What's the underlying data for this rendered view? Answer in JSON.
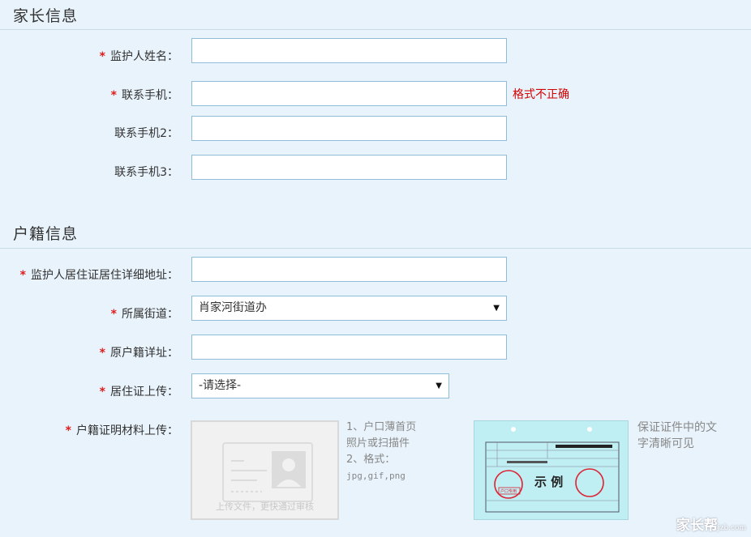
{
  "parent_section": {
    "title": "家长信息",
    "guardian_name_label": "监护人姓名：",
    "phone_label": "联系手机：",
    "phone_error": "格式不正确",
    "phone2_label": "联系手机2：",
    "phone3_label": "联系手机3："
  },
  "household_section": {
    "title": "户籍信息",
    "address_label": "监护人居住证居住详细地址：",
    "street_label": "所属街道：",
    "street_value": "肖家河街道办",
    "origin_label": "原户籍详址：",
    "residence_permit_label": "居住证上传：",
    "residence_permit_value": "-请选择-",
    "proof_label": "户籍证明材料上传：",
    "upload_text": "上传文件，更快通过审核",
    "hint_line1": "1、户口薄首页",
    "hint_line2": "照片或扫描件",
    "hint_line3": "2、格式：",
    "hint_formats": "jpg,gif,png",
    "sample_hint": "保证证件中的文字清晰可见",
    "sample_stamp": "示 例",
    "sample_caption": "户口专用"
  },
  "required_mark": "*",
  "watermark": {
    "main": "家长帮",
    "sub": "jzb.com"
  },
  "colors": {
    "background": "#e8f3fb",
    "required": "#e01b1b",
    "error": "#d40000",
    "input_border": "#8fbcd8"
  }
}
